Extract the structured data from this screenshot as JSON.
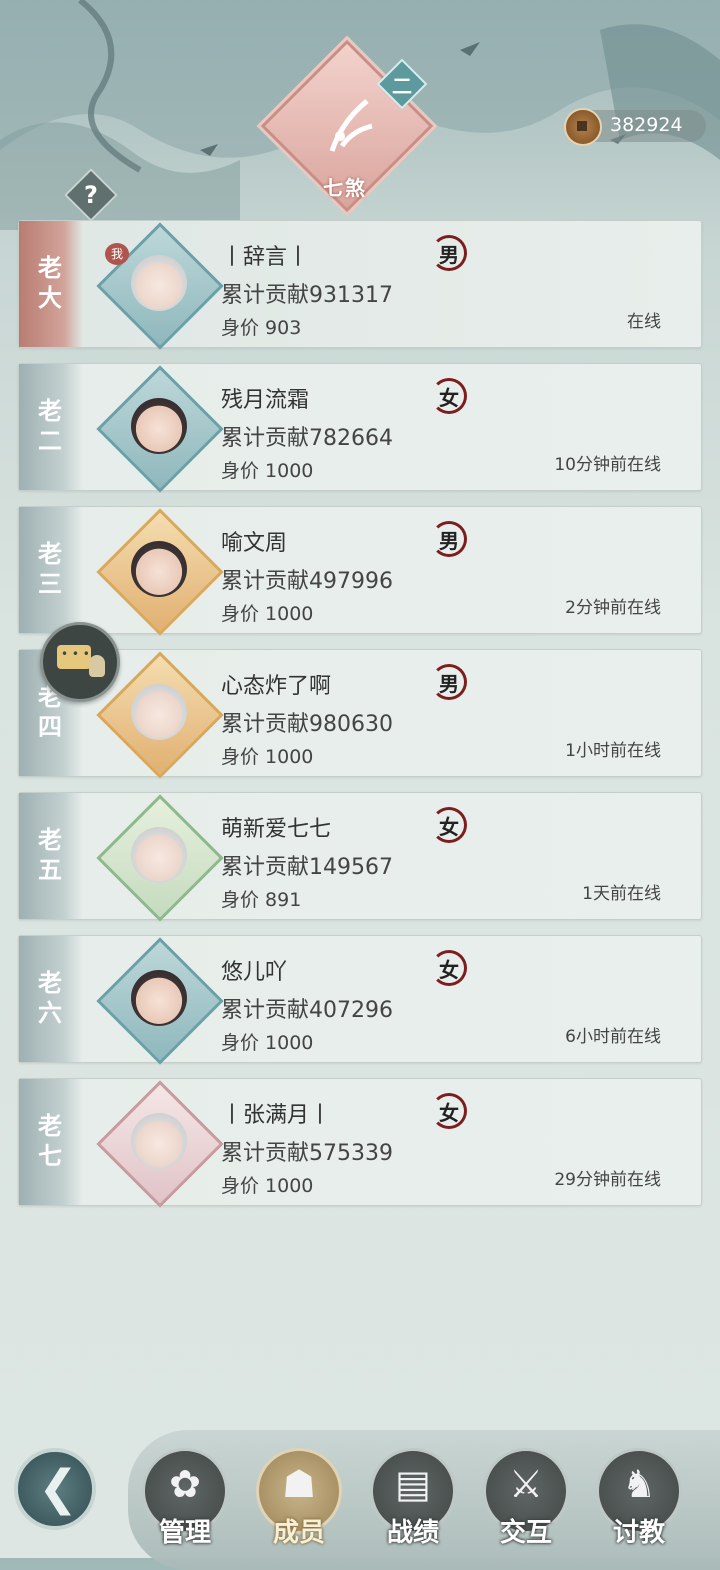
{
  "header": {
    "emblem_text": "七煞",
    "rank_badge": "二",
    "help_icon": "question-icon",
    "currency": {
      "icon": "copper-coin-icon",
      "value": "382924"
    }
  },
  "members": [
    {
      "rank": "老大",
      "name": "丨辞言丨",
      "contribution": "累计贡献931317",
      "worth": "身价 903",
      "gender": "男",
      "status": "在线",
      "is_me": true,
      "me_tag": "我"
    },
    {
      "rank": "老二",
      "name": "残月流霜",
      "contribution": "累计贡献782664",
      "worth": "身价 1000",
      "gender": "女",
      "status": "10分钟前在线"
    },
    {
      "rank": "老三",
      "name": "喻文周",
      "contribution": "累计贡献497996",
      "worth": "身价 1000",
      "gender": "男",
      "status": "2分钟前在线"
    },
    {
      "rank": "老四",
      "name": "心态炸了啊",
      "contribution": "累计贡献980630",
      "worth": "身价 1000",
      "gender": "男",
      "status": "1小时前在线"
    },
    {
      "rank": "老五",
      "name": "萌新爱七七",
      "contribution": "累计贡献149567",
      "worth": "身价 891",
      "gender": "女",
      "status": "1天前在线"
    },
    {
      "rank": "老六",
      "name": "悠儿吖",
      "contribution": "累计贡献407296",
      "worth": "身价 1000",
      "gender": "女",
      "status": "6小时前在线"
    },
    {
      "rank": "老七",
      "name": "丨张满月丨",
      "contribution": "累计贡献575339",
      "worth": "身价 1000",
      "gender": "女",
      "status": "29分钟前在线"
    }
  ],
  "floating": {
    "chat_icon": "chat-bubble-icon"
  },
  "nav": {
    "back_icon": "back-arrow-icon",
    "items": [
      {
        "label": "管理",
        "icon": "manage-icon"
      },
      {
        "label": "成员",
        "icon": "members-icon",
        "active": true
      },
      {
        "label": "战绩",
        "icon": "record-scroll-icon"
      },
      {
        "label": "交互",
        "icon": "interact-icon"
      },
      {
        "label": "讨教",
        "icon": "duel-icon"
      }
    ]
  },
  "colors": {
    "accent_me": "#b87c72",
    "gender_ring": "#7c1e1e",
    "active_nav": "#a99366"
  }
}
